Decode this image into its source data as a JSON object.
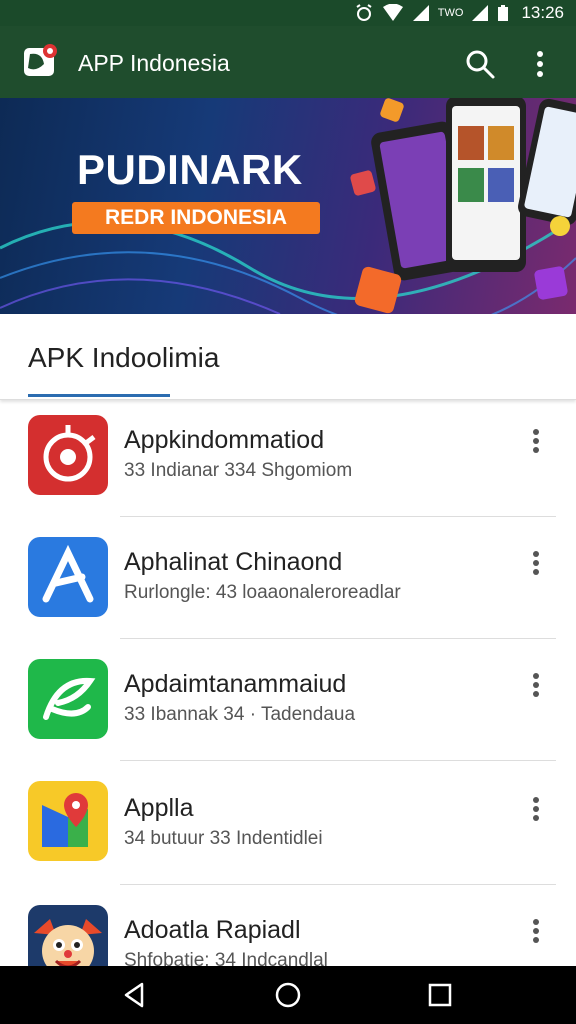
{
  "status_bar": {
    "time": "13:26",
    "indicator": "TWO"
  },
  "app_bar": {
    "title": "APP Indonesia"
  },
  "banner": {
    "title": "PUDINARK",
    "subtitle": "REDR INDONESIA"
  },
  "tab": {
    "label": "APK Indoolimia"
  },
  "apps": [
    {
      "name": "Appkindommatiod",
      "meta": "33 Indianar 334 Shgomiom",
      "icon": "target-icon"
    },
    {
      "name": "Aphalinat Chinaond",
      "meta": "Rurlongle: 43 loaaonaleroreadlar",
      "icon": "letter-a-icon"
    },
    {
      "name": "Apdaimtanammaiud",
      "meta": "33 Ibannak 34 · Tadendaua",
      "icon": "leaf-icon"
    },
    {
      "name": "Applla",
      "meta": "34 butuur 33 Indentidlei",
      "icon": "map-pin-icon"
    },
    {
      "name": "Adoatla Rapiadl",
      "meta": "Shfobatie: 34 Indcandlal",
      "icon": "clown-face-icon"
    }
  ],
  "colors": {
    "app_bar": "#1f4d2d",
    "status_bar": "#1b4a2a",
    "accent_orange": "#f47a1f",
    "tab_underline": "#2b6cb0"
  }
}
